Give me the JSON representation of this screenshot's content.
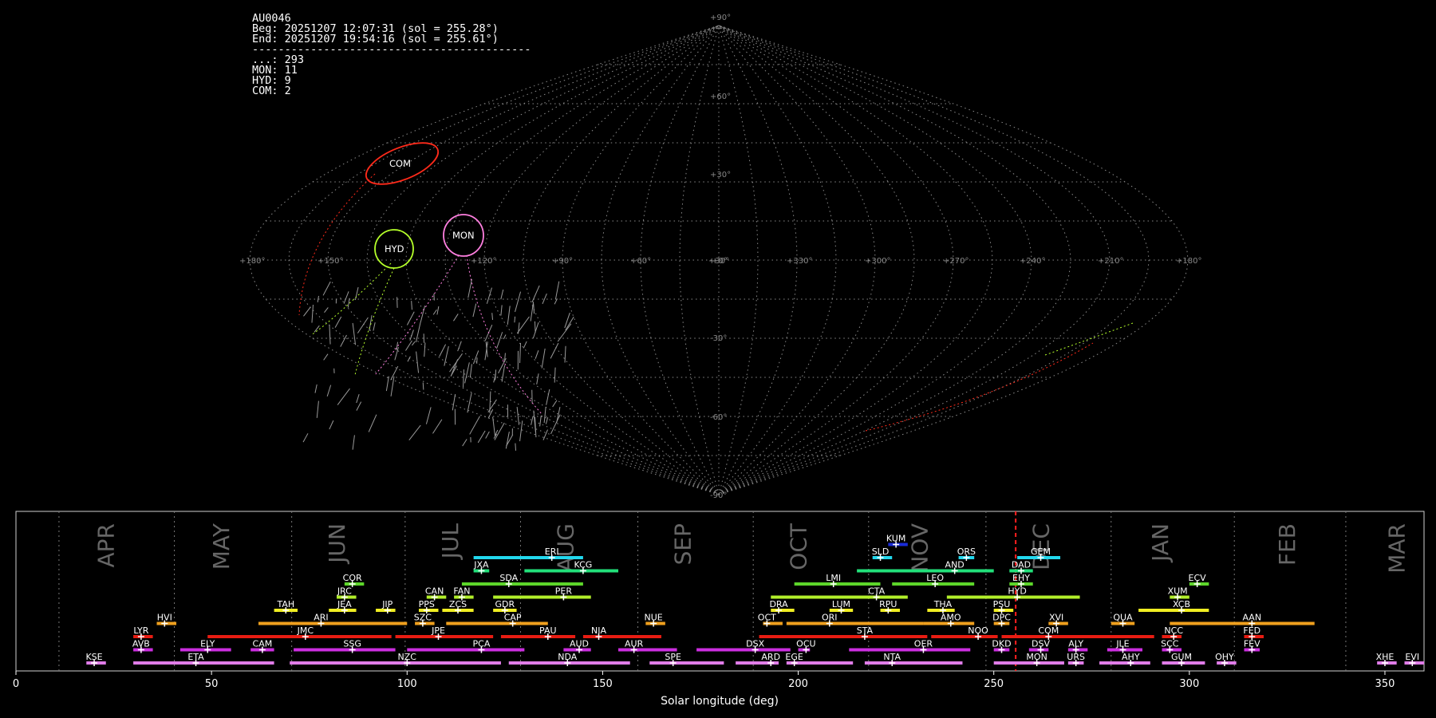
{
  "info": {
    "station": "AU0046",
    "begin": "Beg: 20251207 12:07:31 (sol = 255.28°)",
    "end": "End: 20251207 19:54:16 (sol = 255.61°)",
    "separator": "-------------------------------------------",
    "counts": [
      {
        "label": "...: 293"
      },
      {
        "label": "MON: 11"
      },
      {
        "label": "HYD: 9"
      },
      {
        "label": "COM: 2"
      }
    ]
  },
  "sky_map": {
    "lon_labels": [
      "+180°",
      "+150°",
      "+120°",
      "+90°",
      "+60°",
      "+30°",
      "+0°",
      "+330°",
      "+300°",
      "+270°",
      "+240°",
      "+210°",
      "+180°"
    ],
    "lat_labels": [
      "+90°",
      "+60°",
      "+30°",
      "-30°",
      "-60°",
      "-90°"
    ],
    "radiants": [
      {
        "code": "COM",
        "color": "#ff2a1a"
      },
      {
        "code": "HYD",
        "color": "#b5ff2a"
      },
      {
        "code": "MON",
        "color": "#ff7fe0"
      }
    ]
  },
  "chart_data": {
    "type": "timeline",
    "xlabel": "Solar longitude (deg)",
    "xlim": [
      0,
      360
    ],
    "xticks": [
      0,
      50,
      100,
      150,
      200,
      250,
      300,
      350
    ],
    "current_sol": 255.6,
    "month_starts": [
      11,
      40.5,
      70.5,
      99.5,
      129,
      159,
      188.5,
      218,
      248,
      280,
      311.5,
      340
    ],
    "months": [
      {
        "name": "APR",
        "x": 25
      },
      {
        "name": "MAY",
        "x": 54.5
      },
      {
        "name": "JUN",
        "x": 84
      },
      {
        "name": "JUL",
        "x": 113
      },
      {
        "name": "AUG",
        "x": 142.5
      },
      {
        "name": "SEP",
        "x": 172.5
      },
      {
        "name": "OCT",
        "x": 202
      },
      {
        "name": "NOV",
        "x": 233
      },
      {
        "name": "DEC",
        "x": 264
      },
      {
        "name": "JAN",
        "x": 294.5
      },
      {
        "name": "FEB",
        "x": 327
      },
      {
        "name": "MAR",
        "x": 355
      }
    ],
    "showers": [
      {
        "code": "KUM",
        "start": 223,
        "end": 228,
        "peak": 225,
        "row": 13,
        "color": "#1a2bd8"
      },
      {
        "code": "ERI",
        "start": 117,
        "end": 145,
        "peak": 137,
        "row": 12,
        "color": "#22d8ee"
      },
      {
        "code": "SLD",
        "start": 219,
        "end": 224,
        "peak": 221,
        "row": 12,
        "color": "#22d8ee"
      },
      {
        "code": "ORS",
        "start": 241,
        "end": 245,
        "peak": 243,
        "row": 12,
        "color": "#22d8ee"
      },
      {
        "code": "GEM",
        "start": 256,
        "end": 267,
        "peak": 262,
        "row": 12,
        "color": "#22d8ee"
      },
      {
        "code": "JXA",
        "start": 117,
        "end": 121,
        "peak": 119,
        "row": 11,
        "color": "#22e07a"
      },
      {
        "code": "KCG",
        "start": 130,
        "end": 154,
        "peak": 145,
        "row": 11,
        "color": "#22e07a"
      },
      {
        "code": "AND",
        "start": 215,
        "end": 250,
        "peak": 240,
        "row": 11,
        "color": "#22e07a"
      },
      {
        "code": "DAD",
        "start": 254,
        "end": 260,
        "peak": 257,
        "row": 11,
        "color": "#22e07a"
      },
      {
        "code": "COR",
        "start": 84,
        "end": 89,
        "peak": 86,
        "row": 10,
        "color": "#5dd62a"
      },
      {
        "code": "SDA",
        "start": 114,
        "end": 145,
        "peak": 126,
        "row": 10,
        "color": "#5dd62a"
      },
      {
        "code": "LMI",
        "start": 199,
        "end": 221,
        "peak": 209,
        "row": 10,
        "color": "#5dd62a"
      },
      {
        "code": "LEO",
        "start": 224,
        "end": 245,
        "peak": 235,
        "row": 10,
        "color": "#5dd62a"
      },
      {
        "code": "EHY",
        "start": 254,
        "end": 260,
        "peak": 257,
        "row": 10,
        "color": "#5dd62a"
      },
      {
        "code": "ECV",
        "start": 300,
        "end": 305,
        "peak": 302,
        "row": 10,
        "color": "#5dd62a"
      },
      {
        "code": "JRC",
        "start": 82,
        "end": 87,
        "peak": 84,
        "row": 9,
        "color": "#b2ee2a"
      },
      {
        "code": "CAN",
        "start": 105,
        "end": 110,
        "peak": 107,
        "row": 9,
        "color": "#b2ee2a"
      },
      {
        "code": "FAN",
        "start": 112,
        "end": 117,
        "peak": 114,
        "row": 9,
        "color": "#b2ee2a"
      },
      {
        "code": "PER",
        "start": 122,
        "end": 147,
        "peak": 140,
        "row": 9,
        "color": "#b2ee2a"
      },
      {
        "code": "CTA",
        "start": 193,
        "end": 228,
        "peak": 220,
        "row": 9,
        "color": "#b2ee2a"
      },
      {
        "code": "HYD",
        "start": 238,
        "end": 272,
        "peak": 256,
        "row": 9,
        "color": "#b2ee2a"
      },
      {
        "code": "XUM",
        "start": 295,
        "end": 300,
        "peak": 297,
        "row": 9,
        "color": "#b2ee2a"
      },
      {
        "code": "TAH",
        "start": 66,
        "end": 72,
        "peak": 69,
        "row": 8,
        "color": "#f0ee22"
      },
      {
        "code": "JEA",
        "start": 80,
        "end": 87,
        "peak": 84,
        "row": 8,
        "color": "#f0ee22"
      },
      {
        "code": "JIP",
        "start": 92,
        "end": 97,
        "peak": 95,
        "row": 8,
        "color": "#f0ee22"
      },
      {
        "code": "PPS",
        "start": 103,
        "end": 108,
        "peak": 105,
        "row": 8,
        "color": "#f0ee22"
      },
      {
        "code": "ZCS",
        "start": 109,
        "end": 117,
        "peak": 113,
        "row": 8,
        "color": "#f0ee22"
      },
      {
        "code": "GDR",
        "start": 122,
        "end": 128,
        "peak": 125,
        "row": 8,
        "color": "#f0ee22"
      },
      {
        "code": "DRA",
        "start": 193,
        "end": 199,
        "peak": 195,
        "row": 8,
        "color": "#f0ee22"
      },
      {
        "code": "LUM",
        "start": 208,
        "end": 214,
        "peak": 211,
        "row": 8,
        "color": "#f0ee22"
      },
      {
        "code": "RPU",
        "start": 221,
        "end": 226,
        "peak": 223,
        "row": 8,
        "color": "#f0ee22"
      },
      {
        "code": "THA",
        "start": 233,
        "end": 240,
        "peak": 237,
        "row": 8,
        "color": "#f0ee22"
      },
      {
        "code": "PSU",
        "start": 250,
        "end": 255,
        "peak": 252,
        "row": 8,
        "color": "#f0ee22"
      },
      {
        "code": "XCB",
        "start": 287,
        "end": 305,
        "peak": 298,
        "row": 8,
        "color": "#f0ee22"
      },
      {
        "code": "HVI",
        "start": 36,
        "end": 41,
        "peak": 38,
        "row": 7,
        "color": "#f0a01e"
      },
      {
        "code": "ARI",
        "start": 62,
        "end": 100,
        "peak": 78,
        "row": 7,
        "color": "#f0a01e"
      },
      {
        "code": "SZC",
        "start": 102,
        "end": 107,
        "peak": 104,
        "row": 7,
        "color": "#f0a01e"
      },
      {
        "code": "CAP",
        "start": 110,
        "end": 136,
        "peak": 127,
        "row": 7,
        "color": "#f0a01e"
      },
      {
        "code": "NUE",
        "start": 161,
        "end": 166,
        "peak": 163,
        "row": 7,
        "color": "#f0a01e"
      },
      {
        "code": "OCT",
        "start": 191,
        "end": 196,
        "peak": 192,
        "row": 7,
        "color": "#f0a01e"
      },
      {
        "code": "ORI",
        "start": 197,
        "end": 232,
        "peak": 208,
        "row": 7,
        "color": "#f0a01e"
      },
      {
        "code": "AMO",
        "start": 232,
        "end": 245,
        "peak": 239,
        "row": 7,
        "color": "#f0a01e"
      },
      {
        "code": "DPC",
        "start": 250,
        "end": 254,
        "peak": 252,
        "row": 7,
        "color": "#f0a01e"
      },
      {
        "code": "XVI",
        "start": 264,
        "end": 269,
        "peak": 266,
        "row": 7,
        "color": "#f0a01e"
      },
      {
        "code": "QUA",
        "start": 280,
        "end": 286,
        "peak": 283,
        "row": 7,
        "color": "#f0a01e"
      },
      {
        "code": "AAN",
        "start": 295,
        "end": 332,
        "peak": 316,
        "row": 7,
        "color": "#f0a01e"
      },
      {
        "code": "LYR",
        "start": 30,
        "end": 35,
        "peak": 32,
        "row": 6,
        "color": "#e81c12"
      },
      {
        "code": "JMC",
        "start": 49,
        "end": 96,
        "peak": 74,
        "row": 6,
        "color": "#e81c12"
      },
      {
        "code": "JPE",
        "start": 97,
        "end": 122,
        "peak": 108,
        "row": 6,
        "color": "#e81c12"
      },
      {
        "code": "PAU",
        "start": 124,
        "end": 143,
        "peak": 136,
        "row": 6,
        "color": "#e81c12"
      },
      {
        "code": "NIA",
        "start": 145,
        "end": 165,
        "peak": 149,
        "row": 6,
        "color": "#e81c12"
      },
      {
        "code": "STA",
        "start": 190,
        "end": 233,
        "peak": 217,
        "row": 6,
        "color": "#e81c12"
      },
      {
        "code": "NOO",
        "start": 234,
        "end": 251,
        "peak": 246,
        "row": 6,
        "color": "#e81c12"
      },
      {
        "code": "COM",
        "start": 252,
        "end": 291,
        "peak": 264,
        "row": 6,
        "color": "#e81c12"
      },
      {
        "code": "NCC",
        "start": 293,
        "end": 298,
        "peak": 296,
        "row": 6,
        "color": "#e81c12"
      },
      {
        "code": "FED",
        "start": 314,
        "end": 319,
        "peak": 316,
        "row": 6,
        "color": "#e81c12"
      },
      {
        "code": "AVB",
        "start": 30,
        "end": 35,
        "peak": 32,
        "row": 5,
        "color": "#cc2ee0"
      },
      {
        "code": "ELY",
        "start": 42,
        "end": 55,
        "peak": 49,
        "row": 5,
        "color": "#cc2ee0"
      },
      {
        "code": "CAM",
        "start": 60,
        "end": 66,
        "peak": 63,
        "row": 5,
        "color": "#cc2ee0"
      },
      {
        "code": "SSG",
        "start": 71,
        "end": 97,
        "peak": 86,
        "row": 5,
        "color": "#cc2ee0"
      },
      {
        "code": "PCA",
        "start": 100,
        "end": 130,
        "peak": 119,
        "row": 5,
        "color": "#cc2ee0"
      },
      {
        "code": "AUD",
        "start": 140,
        "end": 147,
        "peak": 144,
        "row": 5,
        "color": "#cc2ee0"
      },
      {
        "code": "AUR",
        "start": 154,
        "end": 169,
        "peak": 158,
        "row": 5,
        "color": "#cc2ee0"
      },
      {
        "code": "DSX",
        "start": 174,
        "end": 198,
        "peak": 189,
        "row": 5,
        "color": "#cc2ee0"
      },
      {
        "code": "OCU",
        "start": 200,
        "end": 203,
        "peak": 202,
        "row": 5,
        "color": "#cc2ee0"
      },
      {
        "code": "OER",
        "start": 213,
        "end": 244,
        "peak": 232,
        "row": 5,
        "color": "#cc2ee0"
      },
      {
        "code": "DKD",
        "start": 250,
        "end": 254,
        "peak": 252,
        "row": 5,
        "color": "#cc2ee0"
      },
      {
        "code": "DSV",
        "start": 259,
        "end": 264,
        "peak": 262,
        "row": 5,
        "color": "#cc2ee0"
      },
      {
        "code": "ALY",
        "start": 269,
        "end": 274,
        "peak": 271,
        "row": 5,
        "color": "#cc2ee0"
      },
      {
        "code": "JLE",
        "start": 279,
        "end": 288,
        "peak": 283,
        "row": 5,
        "color": "#cc2ee0"
      },
      {
        "code": "SCC",
        "start": 293,
        "end": 298,
        "peak": 295,
        "row": 5,
        "color": "#cc2ee0"
      },
      {
        "code": "FEV",
        "start": 314,
        "end": 318,
        "peak": 316,
        "row": 5,
        "color": "#cc2ee0"
      },
      {
        "code": "KSE",
        "start": 18,
        "end": 23,
        "peak": 20,
        "row": 4,
        "color": "#e07ce8"
      },
      {
        "code": "ETA",
        "start": 30,
        "end": 66,
        "peak": 46,
        "row": 4,
        "color": "#e07ce8"
      },
      {
        "code": "NZC",
        "start": 70,
        "end": 124,
        "peak": 100,
        "row": 4,
        "color": "#e07ce8"
      },
      {
        "code": "NDA",
        "start": 126,
        "end": 157,
        "peak": 141,
        "row": 4,
        "color": "#e07ce8"
      },
      {
        "code": "SPE",
        "start": 162,
        "end": 181,
        "peak": 168,
        "row": 4,
        "color": "#e07ce8"
      },
      {
        "code": "ARD",
        "start": 184,
        "end": 195,
        "peak": 193,
        "row": 4,
        "color": "#e07ce8"
      },
      {
        "code": "EGE",
        "start": 197,
        "end": 214,
        "peak": 199,
        "row": 4,
        "color": "#e07ce8"
      },
      {
        "code": "NTA",
        "start": 217,
        "end": 242,
        "peak": 224,
        "row": 4,
        "color": "#e07ce8"
      },
      {
        "code": "MON",
        "start": 250,
        "end": 268,
        "peak": 261,
        "row": 4,
        "color": "#e07ce8"
      },
      {
        "code": "URS",
        "start": 269,
        "end": 273,
        "peak": 271,
        "row": 4,
        "color": "#e07ce8"
      },
      {
        "code": "AHY",
        "start": 277,
        "end": 290,
        "peak": 285,
        "row": 4,
        "color": "#e07ce8"
      },
      {
        "code": "GUM",
        "start": 293,
        "end": 304,
        "peak": 298,
        "row": 4,
        "color": "#e07ce8"
      },
      {
        "code": "OHY",
        "start": 307,
        "end": 312,
        "peak": 309,
        "row": 4,
        "color": "#e07ce8"
      },
      {
        "code": "XHE",
        "start": 348,
        "end": 353,
        "peak": 350,
        "row": 4,
        "color": "#e07ce8"
      },
      {
        "code": "EVI",
        "start": 355,
        "end": 360,
        "peak": 357,
        "row": 4,
        "color": "#e07ce8"
      }
    ]
  }
}
